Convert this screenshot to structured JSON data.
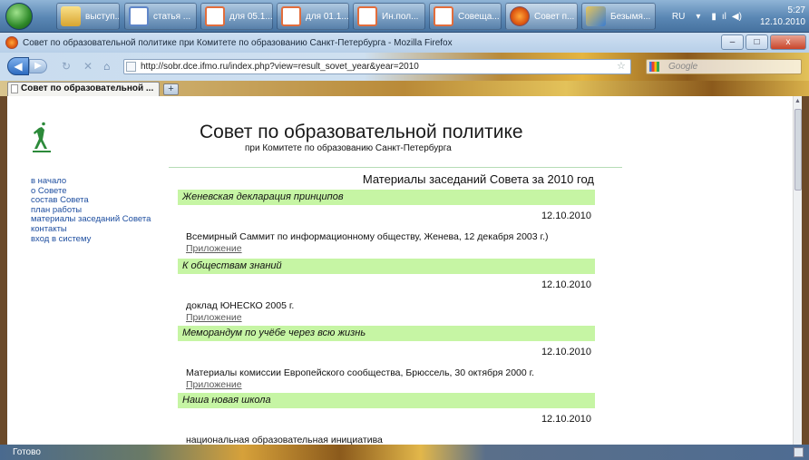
{
  "taskbar": {
    "buttons": [
      {
        "label": "выступ..."
      },
      {
        "label": "статья ..."
      },
      {
        "label": "для 05.1..."
      },
      {
        "label": "для 01.1..."
      },
      {
        "label": "Ин.пол..."
      },
      {
        "label": "Совеща..."
      },
      {
        "label": "Совет п..."
      },
      {
        "label": "Безымя..."
      }
    ],
    "language": "RU",
    "time": "5:27",
    "date": "12.10.2010"
  },
  "window": {
    "title": "Совет по образовательной политике при Комитете по образованию Санкт-Петербурга - Mozilla Firefox",
    "minimize": "–",
    "maximize": "□",
    "close": "x"
  },
  "navbar": {
    "url": "http://sobr.dce.ifmo.ru/index.php?view=result_sovet_year&year=2010",
    "search_placeholder": "Google"
  },
  "tabs": {
    "active_label": "Совет по образовательной ...",
    "new_tab": "+"
  },
  "site": {
    "title": "Совет по образовательной политике",
    "subtitle": "при Комитете по образованию Санкт-Петербурга",
    "colors": {
      "accent_band": "#c6f5a4",
      "link": "#1f4fa0"
    }
  },
  "sidebar": {
    "links": [
      {
        "label": "в начало"
      },
      {
        "label": "о Совете"
      },
      {
        "label": "состав Совета"
      },
      {
        "label": "план работы"
      },
      {
        "label": "материалы заседаний Совета"
      },
      {
        "label": "контакты"
      },
      {
        "label": "вход в систему"
      }
    ]
  },
  "main": {
    "section_title": "Материалы заседаний Совета за 2010 год",
    "entries": [
      {
        "title": "Женевская декларация принципов",
        "date": "12.10.2010",
        "description": "Всемирный Саммит по информационному обществу, Женева, 12 декабря 2003 г.)",
        "link": "Приложение"
      },
      {
        "title": "К обществам знаний",
        "date": "12.10.2010",
        "description": "доклад ЮНЕСКО 2005 г.",
        "link": "Приложение"
      },
      {
        "title": "Меморандум по учёбе через всю жизнь",
        "date": "12.10.2010",
        "description": "Материалы комиссии Европейского сообщества, Брюссель, 30 октября 2000 г.",
        "link": "Приложение"
      },
      {
        "title": "Наша новая школа",
        "date": "12.10.2010",
        "description": "национальная образовательная инициатива",
        "link": ""
      }
    ]
  },
  "statusbar": {
    "text": "Готово"
  }
}
